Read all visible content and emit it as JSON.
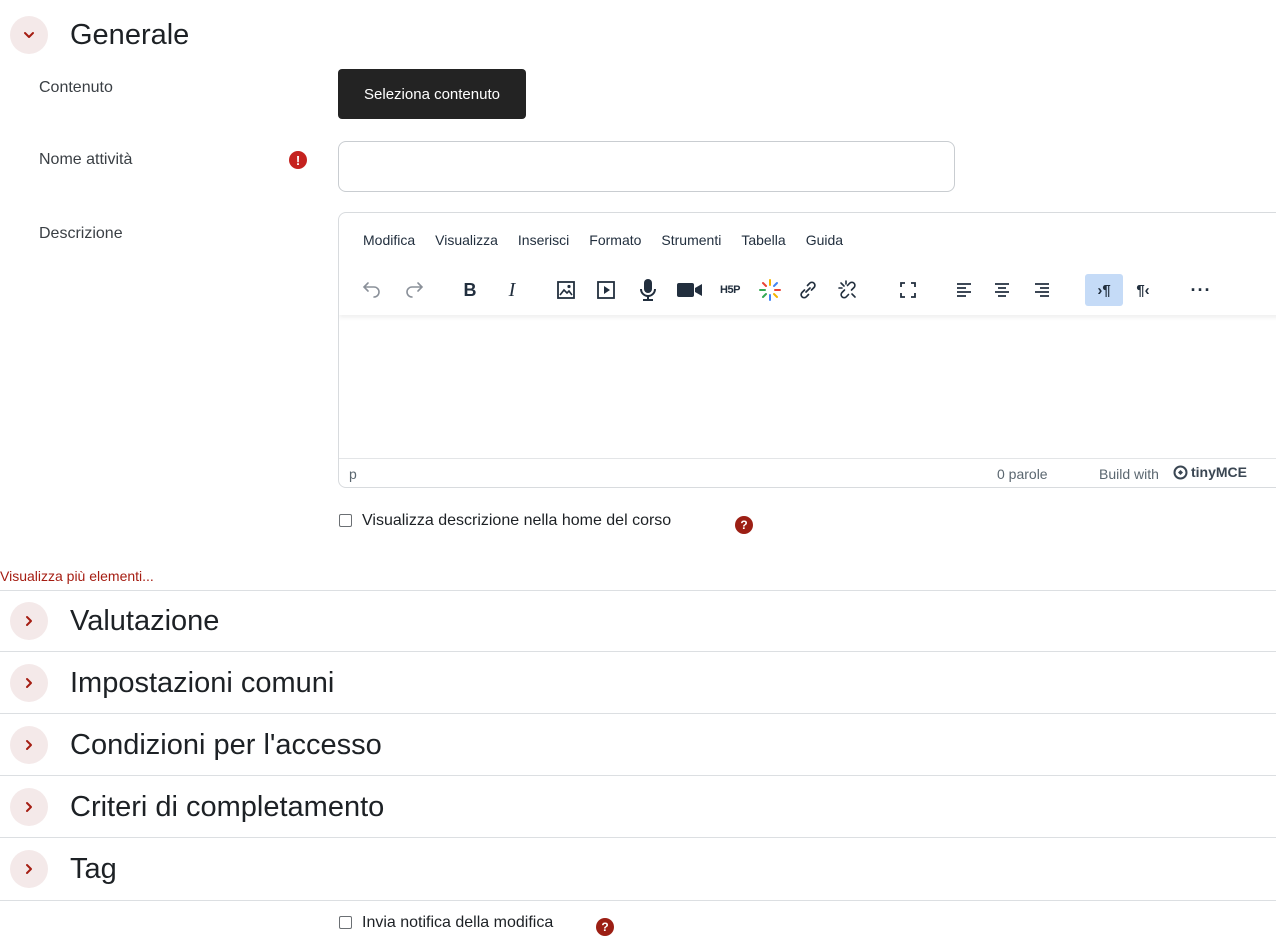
{
  "sections": {
    "generale": "Generale",
    "valutazione": "Valutazione",
    "impostazioni": "Impostazioni comuni",
    "condizioni": "Condizioni per l'accesso",
    "criteri": "Criteri di completamento",
    "tag": "Tag"
  },
  "form": {
    "contenuto_label": "Contenuto",
    "seleziona_button": "Seleziona contenuto",
    "nome_label": "Nome attività",
    "nome_value": "",
    "descrizione_label": "Descrizione",
    "show_desc_label": "Visualizza descrizione nella home del corso",
    "show_more_link": "Visualizza più elementi...",
    "notify_label": "Invia notifica della modifica"
  },
  "editor": {
    "menu": [
      "Modifica",
      "Visualizza",
      "Inserisci",
      "Formato",
      "Strumenti",
      "Tabella",
      "Guida"
    ],
    "status_path": "p",
    "word_count": "0 parole",
    "build_with": "Build with",
    "brand": "tinyMCE"
  },
  "colors": {
    "accent": "#a51d12",
    "dark_button": "#232323",
    "toggle_bg": "#f4e9e9",
    "active_tool": "#c5dbf7"
  },
  "icons": {
    "expand": "chevron-down-icon",
    "collapsed": "chevron-right-icon",
    "required": "exclamation-circle-icon",
    "help": "question-circle-icon"
  }
}
